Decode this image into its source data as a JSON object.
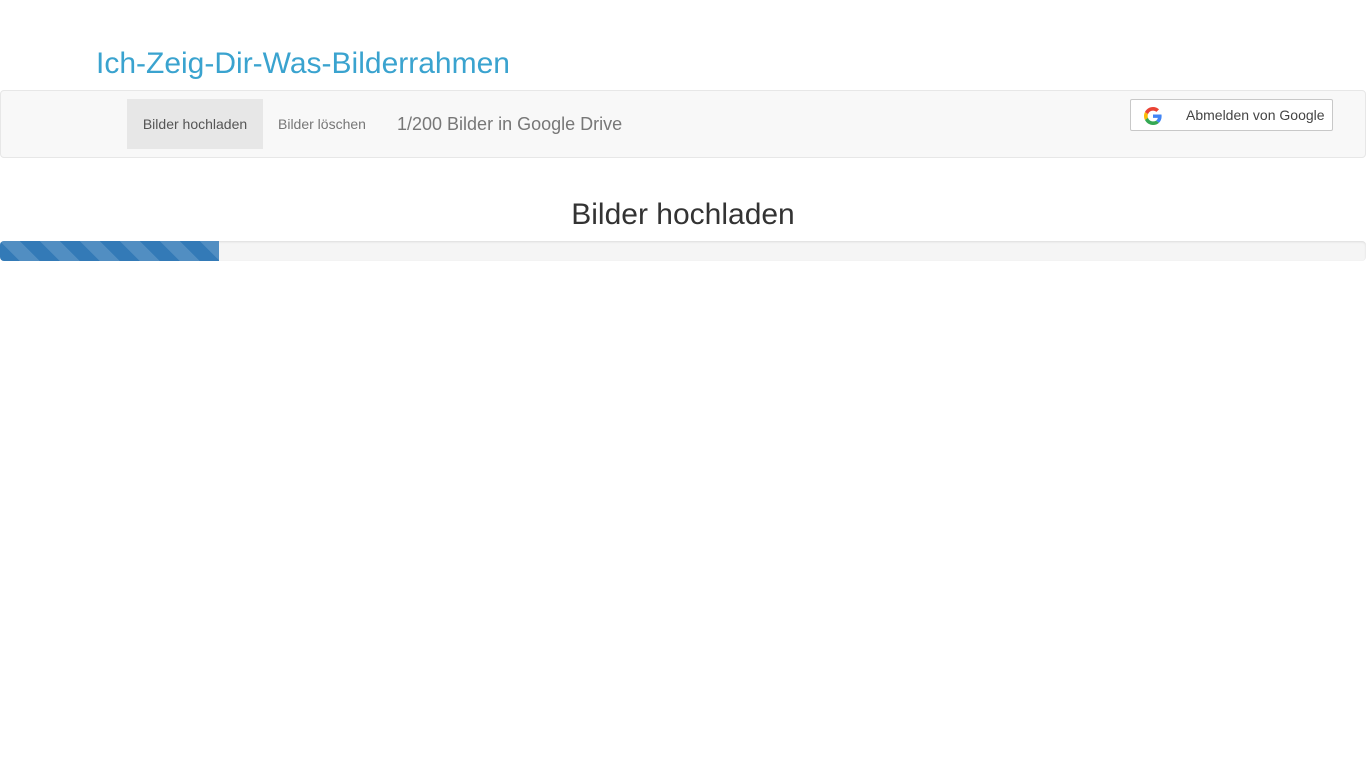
{
  "brand": {
    "title": "Ich-Zeig-Dir-Was-Bilderrahmen",
    "color": "#3aa3cf"
  },
  "navbar": {
    "items": [
      {
        "label": "Bilder hochladen",
        "active": true
      },
      {
        "label": "Bilder löschen",
        "active": false
      }
    ],
    "count_text": "1/200 Bilder in Google Drive",
    "signout": {
      "label": "Abmelden von Google",
      "icon": "google-icon"
    }
  },
  "main": {
    "heading": "Bilder hochladen",
    "progress": {
      "fraction": 0.16,
      "color": "#337ab7",
      "striped": true
    }
  }
}
